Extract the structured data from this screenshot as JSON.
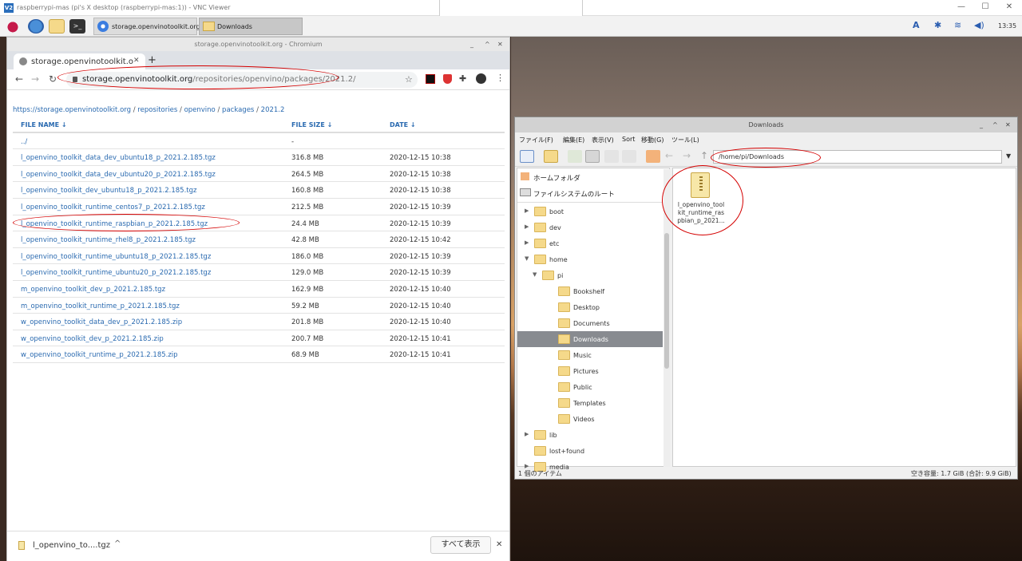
{
  "vnc": {
    "title": "raspberrypi-mas (pi's X desktop (raspberrypi-mas:1)) - VNC Viewer",
    "logo": "V2",
    "minimize": "—",
    "maximize": "☐",
    "close": "✕"
  },
  "taskbar": {
    "tasks": [
      {
        "label": "storage.openvinotoolkit.org..."
      },
      {
        "label": "Downloads"
      }
    ],
    "clock": "13:35",
    "tray_keyboard": "A"
  },
  "chromium": {
    "window_title": "storage.openvinotoolkit.org - Chromium",
    "tab_title": "storage.openvinotoolkit.o",
    "new_tab": "+",
    "url_host": "storage.openvinotoolkit.org",
    "url_path": "/repositories/openvino/packages/2021.2/",
    "breadcrumb": {
      "root": "https://storage.openvinotoolkit.org",
      "parts": [
        "repositories",
        "openvino",
        "packages",
        "2021.2"
      ]
    },
    "columns": {
      "name": "FILE NAME ↓",
      "size": "FILE SIZE ↓",
      "date": "DATE ↓"
    },
    "rows": [
      {
        "name": "../",
        "size": "-",
        "date": ""
      },
      {
        "name": "l_openvino_toolkit_data_dev_ubuntu18_p_2021.2.185.tgz",
        "size": "316.8 MB",
        "date": "2020-12-15 10:38"
      },
      {
        "name": "l_openvino_toolkit_data_dev_ubuntu20_p_2021.2.185.tgz",
        "size": "264.5 MB",
        "date": "2020-12-15 10:38"
      },
      {
        "name": "l_openvino_toolkit_dev_ubuntu18_p_2021.2.185.tgz",
        "size": "160.8 MB",
        "date": "2020-12-15 10:38"
      },
      {
        "name": "l_openvino_toolkit_runtime_centos7_p_2021.2.185.tgz",
        "size": "212.5 MB",
        "date": "2020-12-15 10:39"
      },
      {
        "name": "l_openvino_toolkit_runtime_raspbian_p_2021.2.185.tgz",
        "size": "24.4 MB",
        "date": "2020-12-15 10:39"
      },
      {
        "name": "l_openvino_toolkit_runtime_rhel8_p_2021.2.185.tgz",
        "size": "42.8 MB",
        "date": "2020-12-15 10:42"
      },
      {
        "name": "l_openvino_toolkit_runtime_ubuntu18_p_2021.2.185.tgz",
        "size": "186.0 MB",
        "date": "2020-12-15 10:39"
      },
      {
        "name": "l_openvino_toolkit_runtime_ubuntu20_p_2021.2.185.tgz",
        "size": "129.0 MB",
        "date": "2020-12-15 10:39"
      },
      {
        "name": "m_openvino_toolkit_dev_p_2021.2.185.tgz",
        "size": "162.9 MB",
        "date": "2020-12-15 10:40"
      },
      {
        "name": "m_openvino_toolkit_runtime_p_2021.2.185.tgz",
        "size": "59.2 MB",
        "date": "2020-12-15 10:40"
      },
      {
        "name": "w_openvino_toolkit_data_dev_p_2021.2.185.zip",
        "size": "201.8 MB",
        "date": "2020-12-15 10:40"
      },
      {
        "name": "w_openvino_toolkit_dev_p_2021.2.185.zip",
        "size": "200.7 MB",
        "date": "2020-12-15 10:41"
      },
      {
        "name": "w_openvino_toolkit_runtime_p_2021.2.185.zip",
        "size": "68.9 MB",
        "date": "2020-12-15 10:41"
      }
    ],
    "download": {
      "file": "l_openvino_to....tgz",
      "show_all": "すべて表示",
      "close": "✕",
      "chevron": "^"
    }
  },
  "file_manager": {
    "window_title": "Downloads",
    "menus": [
      "ファイル(F)",
      "編集(E)",
      "表示(V)",
      "Sort",
      "移動(G)",
      "ツール(L)"
    ],
    "path": "/home/pi/Downloads",
    "places": [
      "ホームフォルダ",
      "ファイルシステムのルート"
    ],
    "tree": [
      {
        "label": "boot",
        "arrow": "▶"
      },
      {
        "label": "dev",
        "arrow": "▶"
      },
      {
        "label": "etc",
        "arrow": "▶"
      },
      {
        "label": "home",
        "arrow": "▼"
      },
      {
        "label": "pi",
        "arrow": "▼"
      },
      {
        "label": "Bookshelf",
        "arrow": ""
      },
      {
        "label": "Desktop",
        "arrow": ""
      },
      {
        "label": "Documents",
        "arrow": ""
      },
      {
        "label": "Downloads",
        "arrow": ""
      },
      {
        "label": "Music",
        "arrow": ""
      },
      {
        "label": "Pictures",
        "arrow": ""
      },
      {
        "label": "Public",
        "arrow": ""
      },
      {
        "label": "Templates",
        "arrow": ""
      },
      {
        "label": "Videos",
        "arrow": ""
      },
      {
        "label": "lib",
        "arrow": "▶"
      },
      {
        "label": "lost+found",
        "arrow": ""
      },
      {
        "label": "media",
        "arrow": "▶"
      }
    ],
    "file_label": "l_openvino_toolkit_runtime_raspbian_p_2021...",
    "status_left": "1 個のアイテム",
    "status_right": "空き容量: 1.7 GiB (合計: 9.9 GiB)"
  }
}
